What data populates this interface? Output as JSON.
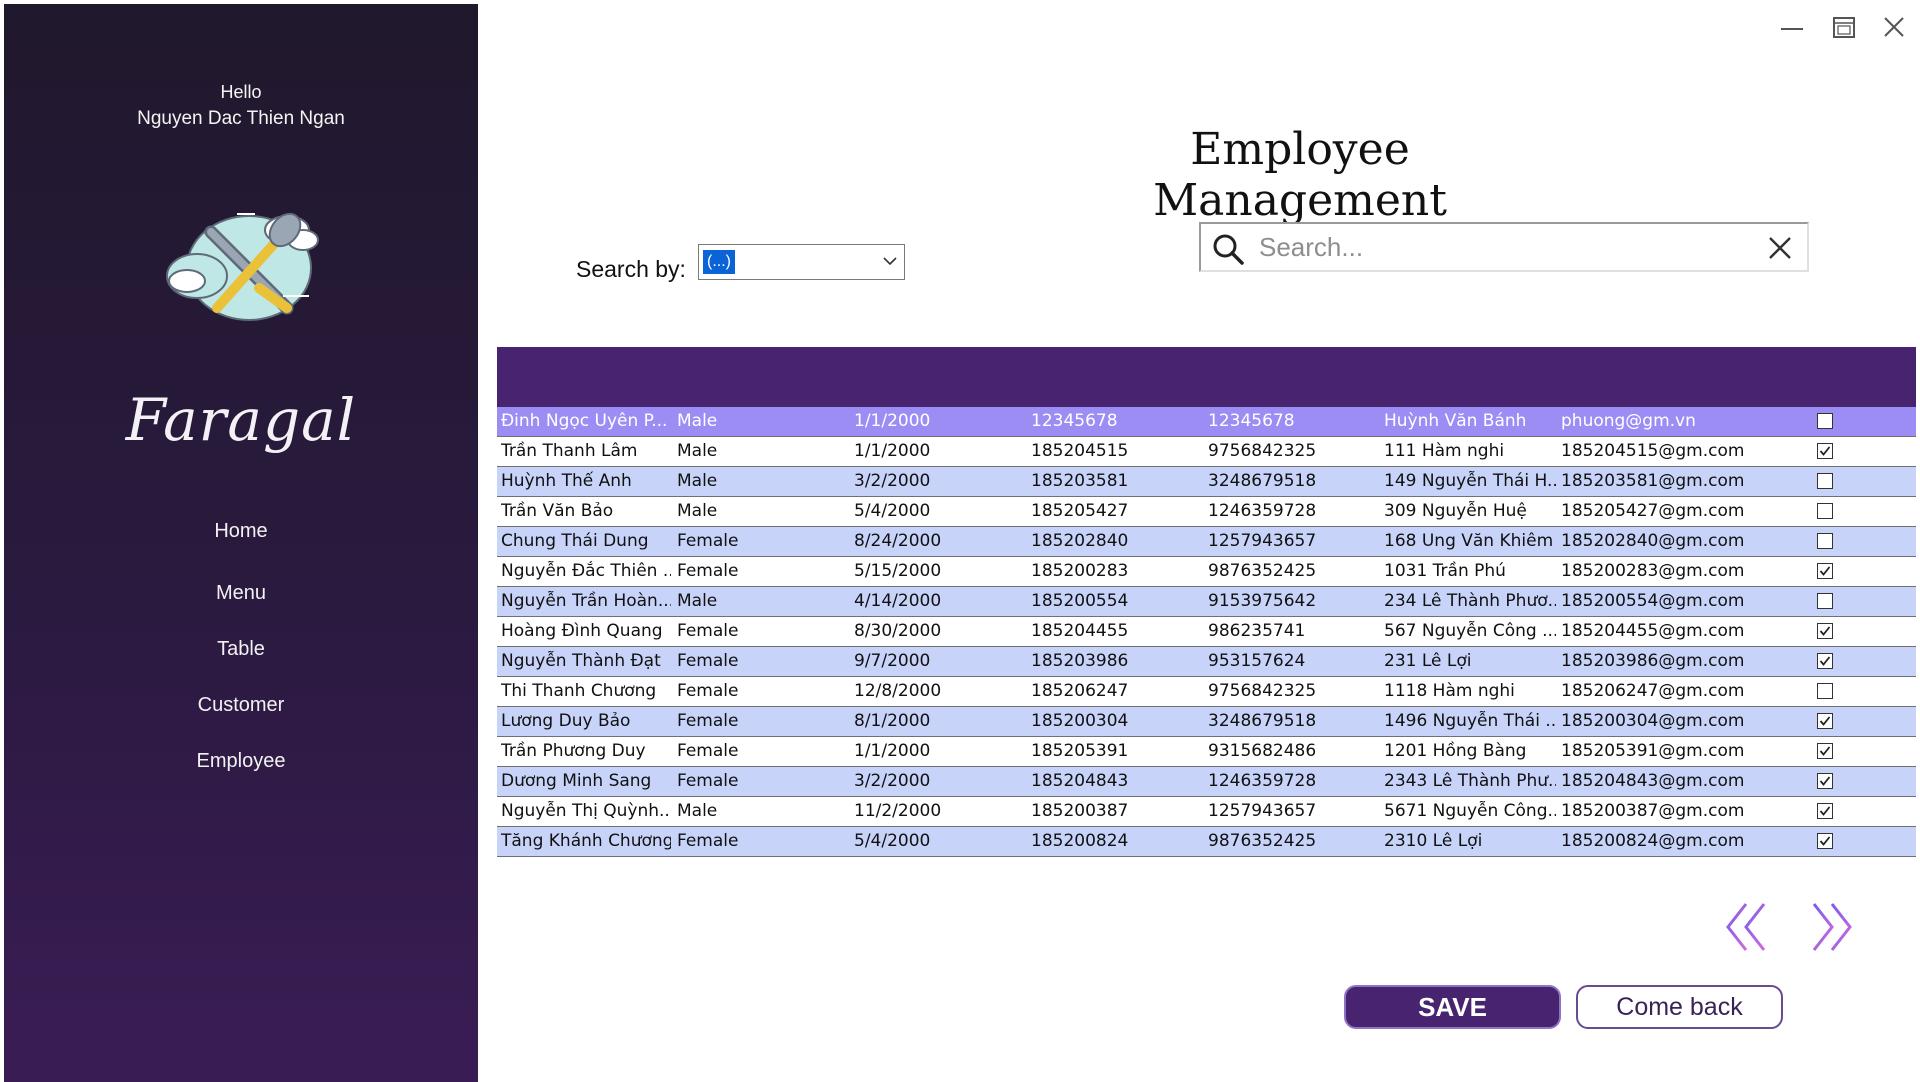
{
  "window": {
    "controls": [
      "minimize-icon",
      "maximize-icon",
      "close-icon"
    ]
  },
  "sidebar": {
    "greeting": "Hello",
    "user_name": "Nguyen Dac Thien Ngan",
    "brand": "Faragal",
    "items": [
      {
        "label": "Home"
      },
      {
        "label": "Menu"
      },
      {
        "label": "Table"
      },
      {
        "label": "Customer"
      },
      {
        "label": "Employee"
      }
    ]
  },
  "header": {
    "title": "Employee Management"
  },
  "search": {
    "by_label": "Search by:",
    "by_value": "(...)",
    "placeholder": "Search..."
  },
  "colors": {
    "sidebar": "#2a1a3f",
    "header": "#48236f",
    "row_alt": "#c8d3f9",
    "row_selected": "#9c8df5"
  },
  "table": {
    "rows": [
      {
        "name": "Đinh Ngọc Uyên P...",
        "gender": "Male",
        "dob": "1/1/2000",
        "id": "12345678",
        "phone": "12345678",
        "address": "Huỳnh Văn Bánh",
        "email": "phuong@gm.vn",
        "checked": false
      },
      {
        "name": "Trần Thanh Lâm",
        "gender": "Male",
        "dob": "1/1/2000",
        "id": "185204515",
        "phone": "9756842325",
        "address": "111 Hàm nghi",
        "email": "185204515@gm.com",
        "checked": true
      },
      {
        "name": "Huỳnh Thế Anh",
        "gender": "Male",
        "dob": "3/2/2000",
        "id": "185203581",
        "phone": "3248679518",
        "address": "149 Nguyễn Thái H...",
        "email": "185203581@gm.com",
        "checked": false
      },
      {
        "name": "Trần Văn Bảo",
        "gender": "Male",
        "dob": "5/4/2000",
        "id": "185205427",
        "phone": "1246359728",
        "address": "309 Nguyễn Huệ",
        "email": "185205427@gm.com",
        "checked": false
      },
      {
        "name": "Chung Thái Dung",
        "gender": "Female",
        "dob": "8/24/2000",
        "id": "185202840",
        "phone": "1257943657",
        "address": "168 Ung Văn Khiêm",
        "email": "185202840@gm.com",
        "checked": false
      },
      {
        "name": "Nguyễn Đắc Thiên ...",
        "gender": "Female",
        "dob": "5/15/2000",
        "id": "185200283",
        "phone": "9876352425",
        "address": "1031 Trần Phú",
        "email": "185200283@gm.com",
        "checked": true
      },
      {
        "name": "Nguyễn Trần Hoàn...",
        "gender": "Male",
        "dob": "4/14/2000",
        "id": "185200554",
        "phone": "9153975642",
        "address": "234 Lê Thành Phươ...",
        "email": "185200554@gm.com",
        "checked": false
      },
      {
        "name": "Hoàng Đình Quang",
        "gender": "Female",
        "dob": "8/30/2000",
        "id": "185204455",
        "phone": "986235741",
        "address": "567 Nguyễn Công ...",
        "email": "185204455@gm.com",
        "checked": true
      },
      {
        "name": "Nguyễn Thành Đạt",
        "gender": "Female",
        "dob": "9/7/2000",
        "id": "185203986",
        "phone": "953157624",
        "address": "231 Lê Lợi",
        "email": "185203986@gm.com",
        "checked": true
      },
      {
        "name": "Thi Thanh Chương",
        "gender": "Female",
        "dob": "12/8/2000",
        "id": "185206247",
        "phone": "9756842325",
        "address": "1118 Hàm nghi",
        "email": "185206247@gm.com",
        "checked": false
      },
      {
        "name": "Lương Duy Bảo",
        "gender": "Female",
        "dob": "8/1/2000",
        "id": "185200304",
        "phone": "3248679518",
        "address": "1496 Nguyễn Thái ...",
        "email": "185200304@gm.com",
        "checked": true
      },
      {
        "name": "Trần Phương Duy",
        "gender": "Female",
        "dob": "1/1/2000",
        "id": "185205391",
        "phone": "9315682486",
        "address": "1201 Hồng Bàng",
        "email": "185205391@gm.com",
        "checked": true
      },
      {
        "name": "Dương Minh Sang",
        "gender": "Female",
        "dob": "3/2/2000",
        "id": "185204843",
        "phone": "1246359728",
        "address": "2343 Lê Thành Phư...",
        "email": "185204843@gm.com",
        "checked": true
      },
      {
        "name": "Nguyễn Thị Quỳnh...",
        "gender": "Male",
        "dob": "11/2/2000",
        "id": "185200387",
        "phone": "1257943657",
        "address": "5671 Nguyễn Công...",
        "email": "185200387@gm.com",
        "checked": true
      },
      {
        "name": "Tăng Khánh Chương",
        "gender": "Female",
        "dob": "5/4/2000",
        "id": "185200824",
        "phone": "9876352425",
        "address": "2310 Lê Lợi",
        "email": "185200824@gm.com",
        "checked": true
      }
    ]
  },
  "pager": {
    "prev_icon": "chevron-left-icon",
    "next_icon": "chevron-right-icon"
  },
  "actions": {
    "save_label": "SAVE",
    "back_label": "Come back"
  }
}
